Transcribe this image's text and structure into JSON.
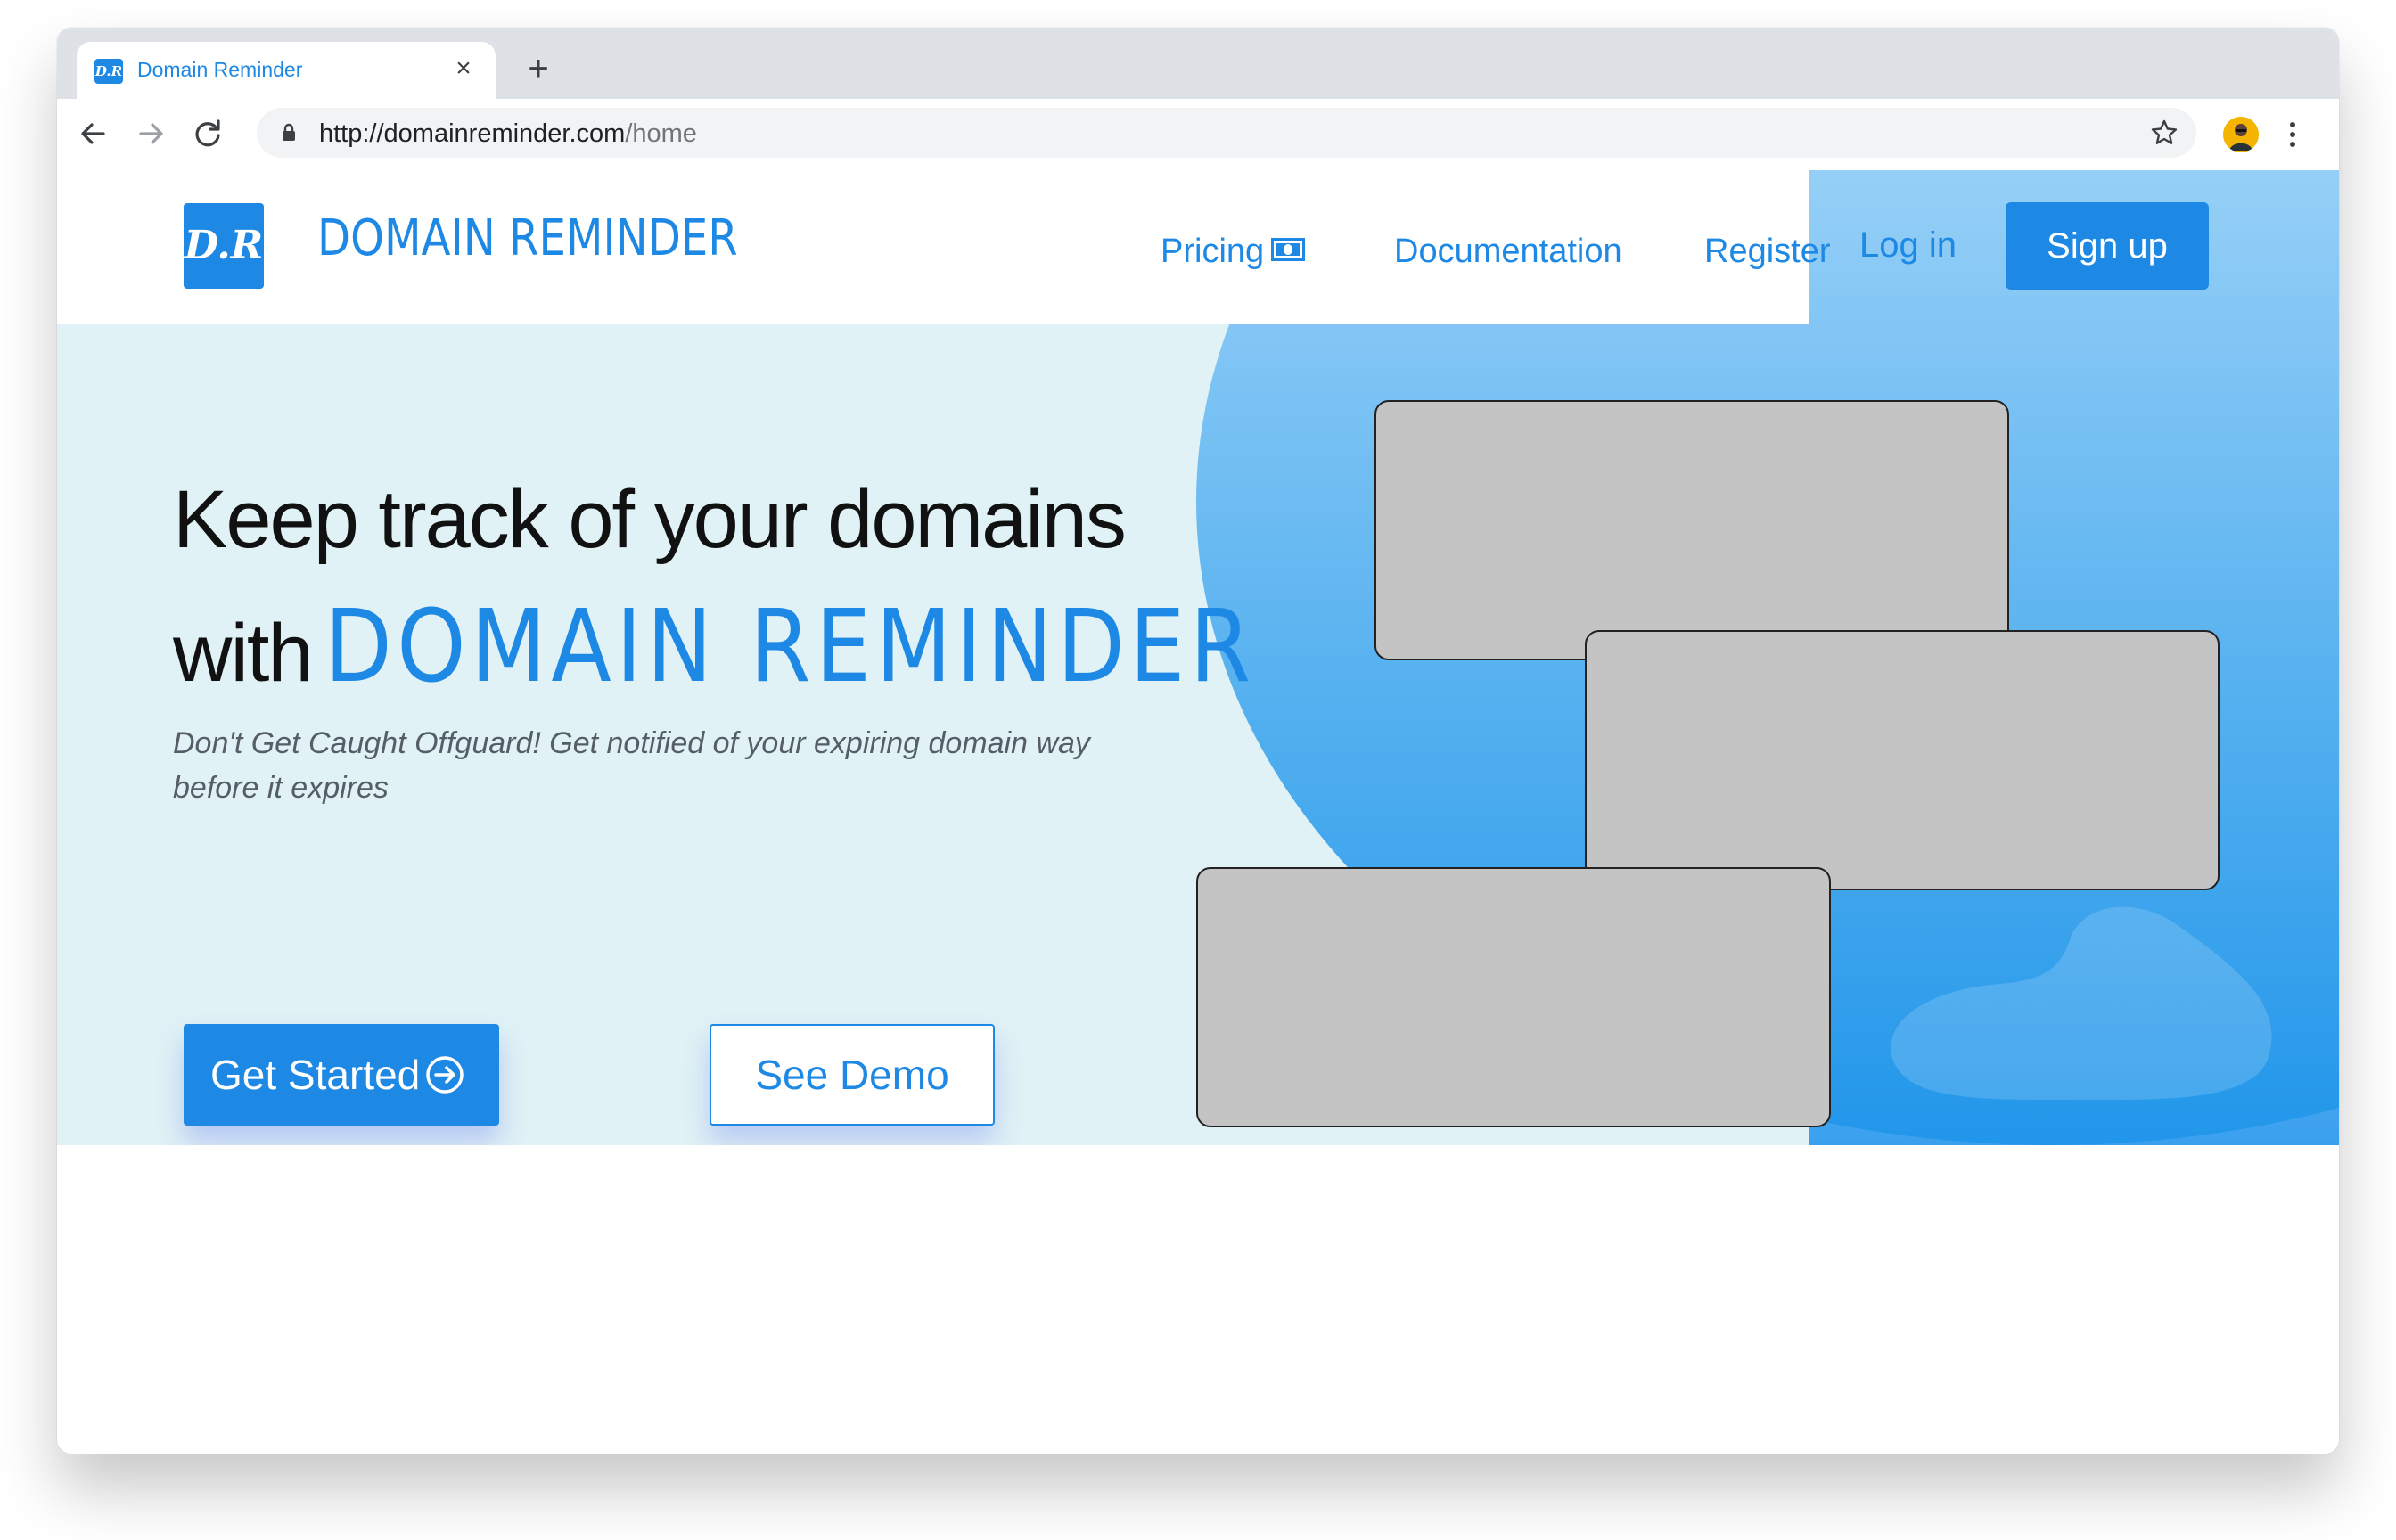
{
  "browser": {
    "tab": {
      "favicon_text": "D.R",
      "title": "Domain Reminder",
      "close_glyph": "×"
    },
    "new_tab_glyph": "+",
    "url": {
      "host": "http://domainreminder.com",
      "path": "/home"
    },
    "icons": [
      "back-arrow-icon",
      "forward-arrow-icon",
      "reload-icon",
      "lock-icon",
      "star-icon",
      "profile-avatar",
      "kebab-menu-icon"
    ]
  },
  "header": {
    "logo_mark": "D.R",
    "logo_text": "DOMAIN REMINDER",
    "nav": {
      "pricing": "Pricing",
      "documentation": "Documentation",
      "register": "Register",
      "login": "Log in",
      "signup": "Sign up"
    }
  },
  "hero": {
    "line1": "Keep track of your domains",
    "line2_prefix": "with",
    "line2_brand": "DOMAIN REMINDER",
    "subtext": "Don't Get Caught Offguard! Get notified of your expiring domain way before it expires",
    "primary_button": "Get Started",
    "secondary_button": "See Demo"
  },
  "colors": {
    "brand_blue": "#1e88e5",
    "hero_background": "#e0f2f5",
    "placeholder_card": "#c4c4c4"
  }
}
